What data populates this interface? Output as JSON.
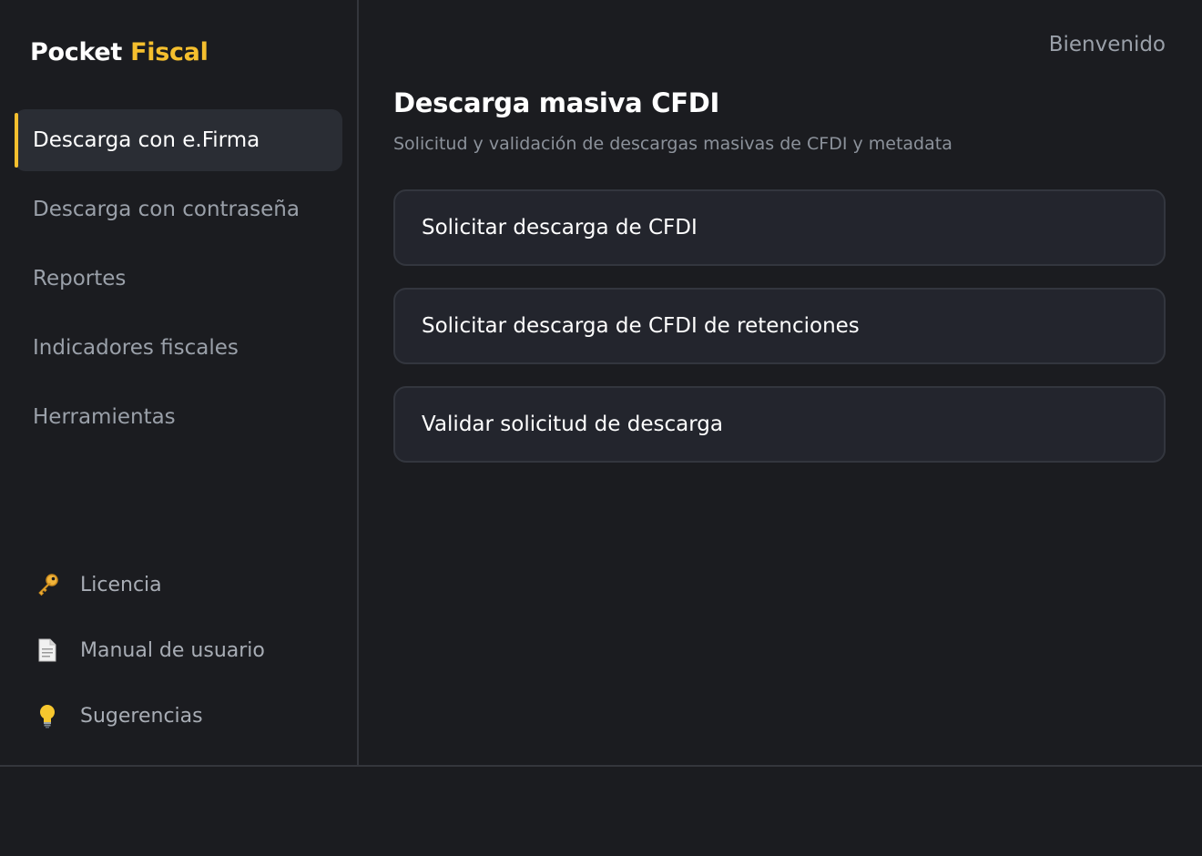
{
  "brand": {
    "part1": "Pocket",
    "part2": "Fiscal",
    "accent_color": "#f5bf2e"
  },
  "header": {
    "welcome": "Bienvenido"
  },
  "sidebar": {
    "items": [
      {
        "label": "Descarga con e.Firma",
        "active": true
      },
      {
        "label": "Descarga con contraseña",
        "active": false
      },
      {
        "label": "Reportes",
        "active": false
      },
      {
        "label": "Indicadores fiscales",
        "active": false
      },
      {
        "label": "Herramientas",
        "active": false
      }
    ],
    "bottom_items": [
      {
        "label": "Licencia",
        "icon": "key-icon"
      },
      {
        "label": "Manual de usuario",
        "icon": "document-icon"
      },
      {
        "label": "Sugerencias",
        "icon": "lightbulb-icon"
      }
    ]
  },
  "main": {
    "title": "Descarga masiva CFDI",
    "subtitle": "Solicitud y validación de descargas masivas de CFDI y metadata",
    "cards": [
      {
        "label": "Solicitar descarga de CFDI"
      },
      {
        "label": "Solicitar descarga de CFDI de retenciones"
      },
      {
        "label": "Validar solicitud de descarga"
      }
    ]
  }
}
